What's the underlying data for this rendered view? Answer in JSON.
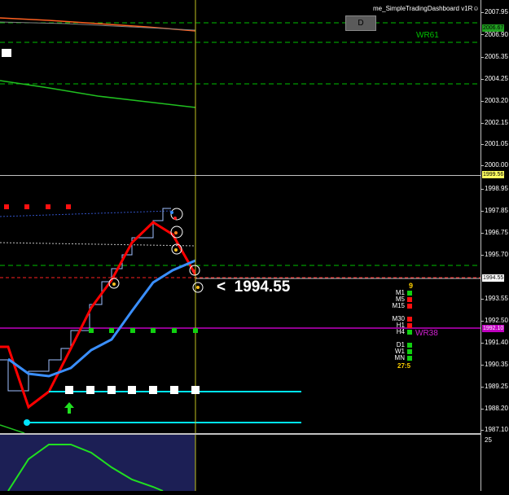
{
  "indicator_title": "me_SimpleTradingDashboard v1R☺",
  "d_button_label": "D",
  "price_axis": {
    "labels": [
      "2007.95",
      "2006.90",
      "2006.67",
      "2005.35",
      "2004.25",
      "2003.20",
      "2002.15",
      "2001.05",
      "2000.00",
      "1999.56",
      "1998.95",
      "1997.85",
      "1996.75",
      "1995.70",
      "1994.55",
      "1993.55",
      "1992.50",
      "1992.10",
      "1991.40",
      "1990.35",
      "1989.25",
      "1988.20",
      "1987.10",
      "25"
    ]
  },
  "highlight_labels": {
    "orange_box": "2006.67",
    "yellow_box": "1999.56",
    "white_box": "1994.55",
    "magenta_box": "1992.10"
  },
  "levels": {
    "wr61": "WR61",
    "wr38": "WR38"
  },
  "current_price_text": "<  1994.55",
  "dashboard": {
    "top_value": "9",
    "timeframes": [
      {
        "label": "M1",
        "status": "green"
      },
      {
        "label": "M5",
        "status": "red"
      },
      {
        "label": "M15",
        "status": "red"
      },
      {
        "label": "M30",
        "status": "red"
      },
      {
        "label": "H1",
        "status": "red"
      },
      {
        "label": "H4",
        "status": "green"
      },
      {
        "label": "D1",
        "status": "green"
      },
      {
        "label": "W1",
        "status": "green"
      },
      {
        "label": "MN",
        "status": "green"
      }
    ],
    "bottom_value": "27:5"
  },
  "colors": {
    "background": "#000000",
    "red_line": "#ff0000",
    "blue_line": "#3a8fff",
    "green_level": "#00c000",
    "cyan_level": "#00e5ff",
    "magenta_level": "#c000c0",
    "orange_ma": "#ff6020",
    "yellow_vline": "#c0c020",
    "oscillator_bg": "#1c1f55"
  }
}
